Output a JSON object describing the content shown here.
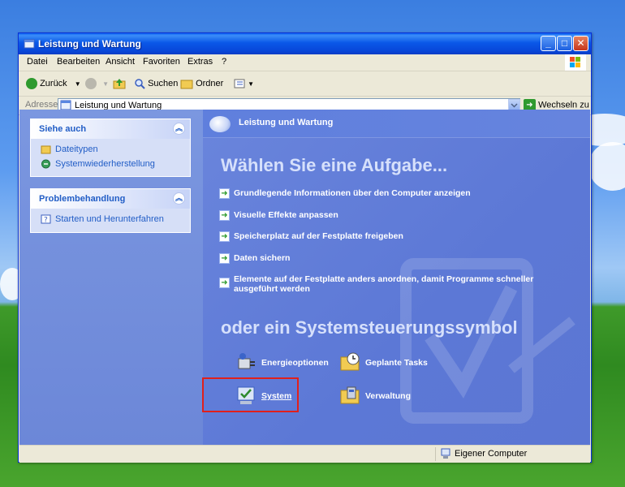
{
  "window": {
    "title": "Leistung und Wartung"
  },
  "menu": [
    "Datei",
    "Bearbeiten",
    "Ansicht",
    "Favoriten",
    "Extras",
    "?"
  ],
  "toolbar": {
    "back_label": "Zurück",
    "search_label": "Suchen",
    "folders_label": "Ordner"
  },
  "address": {
    "label": "Adresse",
    "value": "Leistung und Wartung",
    "go_label": "Wechseln zu"
  },
  "sidebar": {
    "see_also": {
      "title": "Siehe auch",
      "items": [
        "Dateitypen",
        "Systemwiederherstellung"
      ]
    },
    "troubleshoot": {
      "title": "Problembehandlung",
      "items": [
        "Starten und Herunterfahren"
      ]
    }
  },
  "main": {
    "header": "Leistung und Wartung",
    "task_title": "Wählen Sie eine Aufgabe...",
    "tasks": [
      "Grundlegende Informationen über den Computer anzeigen",
      "Visuelle Effekte anpassen",
      "Speicherplatz auf der Festplatte freigeben",
      "Daten sichern",
      "Elemente auf der Festplatte anders anordnen, damit Programme schneller ausgeführt werden"
    ],
    "icon_title": "oder ein Systemsteuerungssymbol",
    "icons": [
      "Energieoptionen",
      "Geplante Tasks",
      "System",
      "Verwaltung"
    ]
  },
  "status": {
    "text": "Eigener Computer"
  },
  "colors": {
    "title_blue": "#0a58e8",
    "highlight": "#e0201c",
    "panel_link": "#215dc6",
    "main_bg": "#5c78d6"
  }
}
